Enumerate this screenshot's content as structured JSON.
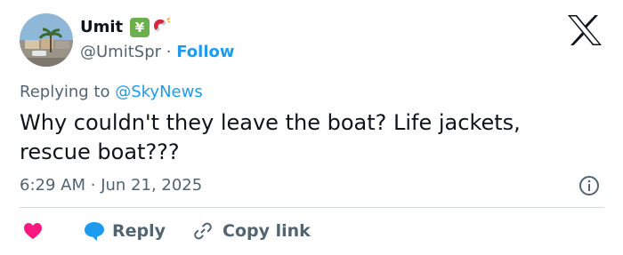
{
  "author": {
    "display_name": "Umit",
    "badges": [
      "yen-banknote-emoji",
      "magnet-emoji"
    ],
    "yen_glyph": "¥",
    "handle": "@UmitSpr",
    "separator": "·",
    "follow_label": "Follow"
  },
  "tweet": {
    "replying_prefix": "Replying to ",
    "replying_to": "@SkyNews",
    "text": "Why couldn't they leave the boat? Life jackets, rescue boat???",
    "time": "6:29 AM",
    "time_separator": "·",
    "date": "Jun 21, 2025"
  },
  "actions": {
    "like_icon": "heart-icon",
    "reply_label": "Reply",
    "copy_link_label": "Copy link"
  },
  "colors": {
    "accent": "#1d9bf0",
    "like": "#f91880",
    "muted_text": "#536471",
    "divider": "#cfd9de"
  }
}
